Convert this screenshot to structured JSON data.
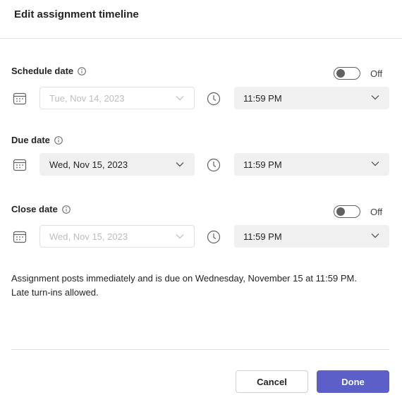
{
  "dialog": {
    "title": "Edit assignment timeline"
  },
  "schedule": {
    "label": "Schedule date",
    "toggle_state": "Off",
    "date_value": "Tue, Nov 14, 2023",
    "date_disabled": true,
    "time_value": "11:59 PM"
  },
  "due": {
    "label": "Due date",
    "date_value": "Wed, Nov 15, 2023",
    "date_disabled": false,
    "time_value": "11:59 PM"
  },
  "close": {
    "label": "Close date",
    "toggle_state": "Off",
    "date_value": "Wed, Nov 15, 2023",
    "date_disabled": true,
    "time_value": "11:59 PM"
  },
  "summary": {
    "line1": "Assignment posts immediately and is due on Wednesday, November 15 at 11:59 PM.",
    "line2": "Late turn-ins allowed."
  },
  "footer": {
    "cancel_label": "Cancel",
    "done_label": "Done"
  },
  "colors": {
    "primary": "#5b5fc7",
    "field_bg": "#f0f0f0",
    "disabled_text": "#bdbdbd",
    "border": "#e0e0e0"
  },
  "icons": {
    "info": "info-icon",
    "calendar": "calendar-icon",
    "clock": "clock-icon",
    "chevron": "chevron-down-icon"
  }
}
